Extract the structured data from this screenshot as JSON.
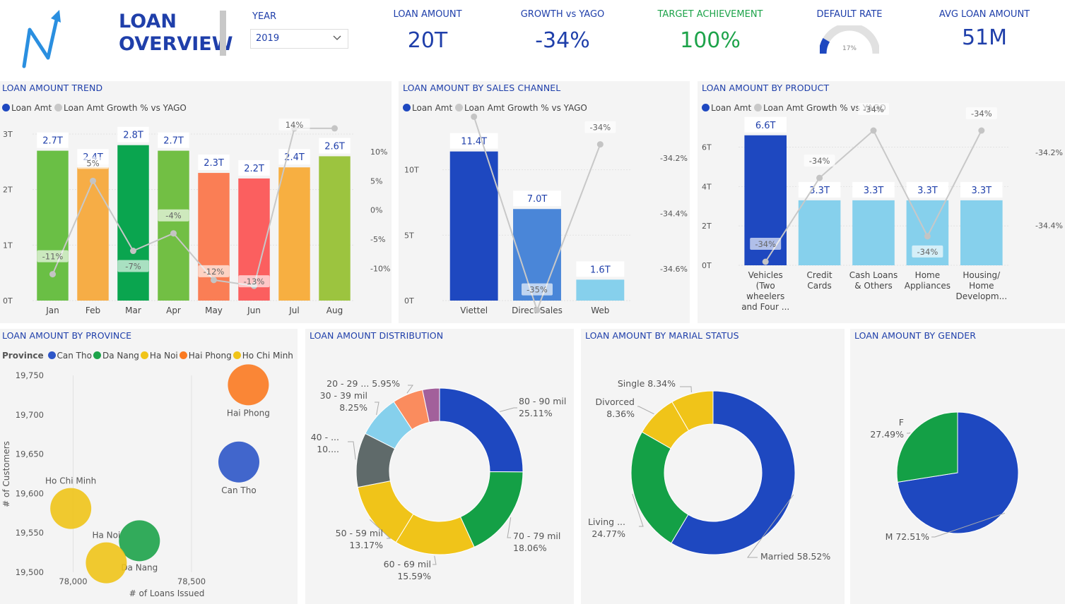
{
  "header": {
    "title_line1": "LOAN",
    "title_line2": "OVERVIEW",
    "year_label": "YEAR",
    "year_value": "2019",
    "kpis": [
      {
        "label": "LOAN AMOUNT",
        "value": "20T",
        "color": "#1f3faa"
      },
      {
        "label": "GROWTH vs YAGO",
        "value": "-34%",
        "color": "#1f3faa"
      },
      {
        "label": "TARGET ACHIEVEMENT",
        "value": "100%",
        "color": "#1da34a"
      },
      {
        "label": "AVG LOAN AMOUNT",
        "value": "51M",
        "color": "#1f3faa"
      }
    ],
    "default_rate": {
      "label": "DEFAULT RATE",
      "value_label": "17%",
      "value": 0.17
    }
  },
  "colors": {
    "accent": "#1f3faa",
    "navy": "#1e48c0",
    "light_blue": "#86d0ec",
    "mid_blue": "#4a86d8",
    "green": "#1da34a",
    "grey_line": "#c8c8c8"
  },
  "legend_common": {
    "amt": "Loan Amt",
    "growth": "Loan Amt Growth % vs YAGO"
  },
  "chart_data": [
    {
      "id": "trend",
      "title": "LOAN AMOUNT TREND",
      "type": "bar",
      "categories": [
        "Jan",
        "Feb",
        "Mar",
        "Apr",
        "May",
        "Jun",
        "Jul",
        "Aug"
      ],
      "values": [
        2.7,
        2.4,
        2.8,
        2.7,
        2.3,
        2.2,
        2.4,
        2.6
      ],
      "value_labels": [
        "2.7T",
        "2.4T",
        "2.8T",
        "2.7T",
        "2.3T",
        "2.2T",
        "2.4T",
        "2.6T"
      ],
      "bar_colors": [
        "#6abf45",
        "#f6ad46",
        "#0aa54f",
        "#72bf44",
        "#fa7e55",
        "#fb5f5f",
        "#f7af41",
        "#9cc43f"
      ],
      "growth": [
        -11,
        5,
        -7,
        -4,
        -12,
        -13,
        14,
        14
      ],
      "growth_labels": [
        "-11%",
        "5%",
        "-7%",
        "-4%",
        "-12%",
        "-13%",
        "14%",
        ""
      ],
      "y_ticks": [
        "0T",
        "1T",
        "2T",
        "3T"
      ],
      "ylim": [
        0,
        3
      ],
      "y2_ticks": [
        "-10%",
        "-5%",
        "0%",
        "5%",
        "10%"
      ],
      "y2lim": [
        -12.5,
        10
      ]
    },
    {
      "id": "channel",
      "title": "LOAN AMOUNT BY SALES CHANNEL",
      "type": "bar",
      "categories": [
        "Viettel",
        "Direct Sales",
        "Web"
      ],
      "values": [
        11.4,
        7.0,
        1.6
      ],
      "value_labels": [
        "11.4T",
        "7.0T",
        "1.6T"
      ],
      "bar_colors": [
        "#1e48c0",
        "#4a86d8",
        "#86d0ec"
      ],
      "growth": [
        -34.05,
        -34.75,
        -34.15
      ],
      "growth_labels": [
        "",
        "-35%",
        "-34%"
      ],
      "y_ticks": [
        "0T",
        "5T",
        "10T"
      ],
      "ylim": [
        0,
        13
      ],
      "y2_ticks": [
        "-34.6%",
        "-34.4%",
        "-34.2%"
      ],
      "y2lim": [
        -34.7,
        -34.1
      ]
    },
    {
      "id": "product",
      "title": "LOAN AMOUNT BY PRODUCT",
      "type": "bar",
      "categories": [
        "Vehicles (Two wheelers and Four ...",
        "Credit Cards",
        "Cash Loans & Others",
        "Home Appliances",
        "Housing/ Home Developm..."
      ],
      "category_lines": [
        [
          "Vehicles",
          "(Two",
          "wheelers",
          "and Four ..."
        ],
        [
          "Credit",
          "Cards"
        ],
        [
          "Cash Loans",
          "& Others"
        ],
        [
          "Home",
          "Appliances"
        ],
        [
          "Housing/",
          "Home",
          "Developm..."
        ]
      ],
      "values": [
        6.6,
        3.3,
        3.3,
        3.3,
        3.3
      ],
      "value_labels": [
        "6.6T",
        "3.3T",
        "3.3T",
        "3.3T",
        "3.3T"
      ],
      "bar_colors": [
        "#1e48c0",
        "#86d0ec",
        "#86d0ec",
        "#86d0ec",
        "#86d0ec"
      ],
      "growth": [
        -34.5,
        -34.27,
        -34.14,
        -34.43,
        -34.14
      ],
      "growth_labels": [
        "-34%",
        "-34%",
        "-34%",
        "-34%",
        "-34%"
      ],
      "y_ticks": [
        "0T",
        "2T",
        "4T",
        "6T"
      ],
      "ylim": [
        0,
        7.2
      ],
      "y2_ticks": [
        "-34.4%",
        "-34.2%"
      ],
      "y2lim": [
        -34.5,
        -34.14
      ]
    },
    {
      "id": "province",
      "title": "LOAN AMOUNT BY PROVINCE",
      "type": "scatter",
      "legend_title": "Province",
      "xlabel": "# of Loans Issued",
      "ylabel": "# of Customers",
      "x_ticks": [
        "78,000",
        "78,500"
      ],
      "y_ticks": [
        "19,500",
        "19,550",
        "19,600",
        "19,650",
        "19,700",
        "19,750"
      ],
      "xlim": [
        77900,
        78900
      ],
      "ylim": [
        19500,
        19750
      ],
      "series": [
        {
          "name": "Can Tho",
          "color": "#2e56c8",
          "x": 78700,
          "y": 19640
        },
        {
          "name": "Da Nang",
          "color": "#1da34a",
          "x": 78280,
          "y": 19540
        },
        {
          "name": "Ha Noi",
          "color": "#f0c419",
          "x": 78140,
          "y": 19512
        },
        {
          "name": "Hai Phong",
          "color": "#fb7a21",
          "x": 78740,
          "y": 19738
        },
        {
          "name": "Ho Chi Minh",
          "color": "#f0c419",
          "x": 77990,
          "y": 19581
        }
      ]
    },
    {
      "id": "distribution",
      "title": "LOAN AMOUNT DISTRIBUTION",
      "type": "pie",
      "donut": true,
      "slices": [
        {
          "label": "80 - 90 mil",
          "pct_label": "25.11%",
          "value": 25.11,
          "color": "#1e48c0"
        },
        {
          "label": "70 - 79 mil",
          "pct_label": "18.06%",
          "value": 18.06,
          "color": "#14a046"
        },
        {
          "label": "60 - 69 mil",
          "pct_label": "15.59%",
          "value": 15.59,
          "color": "#f0c419"
        },
        {
          "label": "50 - 59 mil",
          "pct_label": "13.17%",
          "value": 13.17,
          "color": "#f0c419"
        },
        {
          "label": "40 - ...",
          "pct_label": "10....",
          "value": 10.57,
          "color": "#5f6a6a"
        },
        {
          "label": "30 - 39 mil",
          "pct_label": "8.25%",
          "value": 8.25,
          "color": "#86d0ec"
        },
        {
          "label": "20 - 29 ...",
          "pct_label": "5.95%",
          "value": 5.95,
          "color": "#fa8c5e"
        },
        {
          "label": "",
          "pct_label": "",
          "value": 3.3,
          "color": "#a2609b"
        }
      ]
    },
    {
      "id": "marital",
      "title": "LOAN AMOUNT BY MARIAL STATUS",
      "type": "pie",
      "donut": true,
      "slices": [
        {
          "label": "Married",
          "pct_label": "58.52%",
          "value": 58.52,
          "color": "#1e48c0"
        },
        {
          "label": "Living ...",
          "pct_label": "24.77%",
          "value": 24.77,
          "color": "#14a046"
        },
        {
          "label": "Divorced",
          "pct_label": "8.36%",
          "value": 8.36,
          "color": "#f0c419"
        },
        {
          "label": "Single",
          "pct_label": "8.34%",
          "value": 8.34,
          "color": "#f0c419"
        }
      ]
    },
    {
      "id": "gender",
      "title": "LOAN AMOUNT BY GENDER",
      "type": "pie",
      "donut": false,
      "slices": [
        {
          "label": "M",
          "pct_label": "72.51%",
          "value": 72.51,
          "color": "#1e48c0"
        },
        {
          "label": "F",
          "pct_label": "27.49%",
          "value": 27.49,
          "color": "#14a046"
        }
      ]
    }
  ]
}
